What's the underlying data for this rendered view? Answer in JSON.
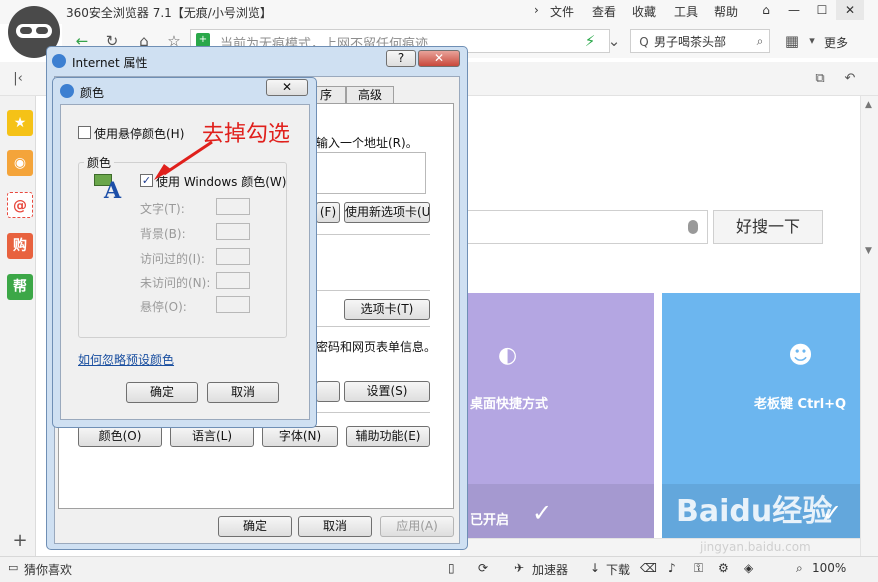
{
  "browser": {
    "title": "360安全浏览器 7.1【无痕/小号浏览】",
    "menu": [
      "文件",
      "查看",
      "收藏",
      "工具",
      "帮助"
    ],
    "address_text": "当前为无痕模式，上网不留任何痕迹",
    "search_text": "男子喝茶头部",
    "more_label": "更多",
    "sidebar_icons": [
      "star-icon",
      "weibo-icon",
      "mail-icon",
      "shop-icon",
      "help-icon"
    ],
    "help_glyph": "帮",
    "shop_glyph": "购"
  },
  "page": {
    "search_button": "好搜一下",
    "tile1_label": "桌面快捷方式",
    "tile1_status": "已开启",
    "tile2_label": "老板键 Ctrl+Q"
  },
  "status": {
    "left": "猜你喜欢",
    "accelerator": "加速器",
    "download": "下载",
    "zoom": "100%"
  },
  "inet_dialog": {
    "title": "Internet 属性",
    "tabs": [
      "序",
      "高级"
    ],
    "home_text": "输入一个地址(R)。",
    "home_btn_current": "(F)",
    "home_btn_newtab": "使用新选项卡(U)",
    "tabs_btn": "选项卡(T)",
    "forms_text": "密码和网页表单信息。",
    "settings_btn": "设置(S)",
    "bottom_btns": [
      "颜色(O)",
      "语言(L)",
      "字体(N)",
      "辅助功能(E)"
    ],
    "ok": "确定",
    "cancel": "取消",
    "apply": "应用(A)"
  },
  "color_dialog": {
    "title": "颜色",
    "use_hover": "使用悬停颜色(H)",
    "group_label": "颜色",
    "use_windows": "使用 Windows 颜色(W)",
    "use_windows_checked": true,
    "rows": [
      "文字(T):",
      "背景(B):",
      "访问过的(I):",
      "未访问的(N):",
      "悬停(O):"
    ],
    "link": "如何忽略预设颜色",
    "ok": "确定",
    "cancel": "取消"
  },
  "annotation": "去掉勾选",
  "watermark": "Baidu经验",
  "watermark_sub": "jingyan.baidu.com"
}
